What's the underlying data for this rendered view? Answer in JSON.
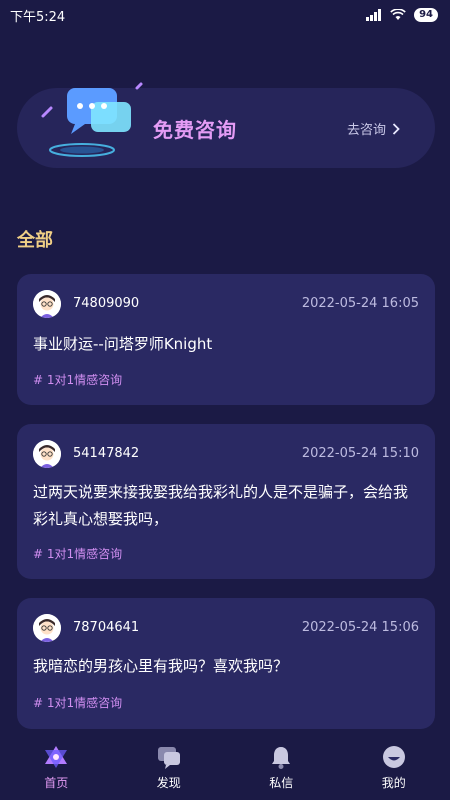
{
  "status_bar": {
    "time": "下午5:24",
    "battery": "94"
  },
  "banner": {
    "title": "免费咨询",
    "link_label": "去咨询"
  },
  "section": {
    "title": "全部"
  },
  "posts": [
    {
      "user_id": "74809090",
      "time": "2022-05-24 16:05",
      "text": "事业财运--问塔罗师Knight",
      "tag": "# 1对1情感咨询"
    },
    {
      "user_id": "54147842",
      "time": "2022-05-24 15:10",
      "text": "过两天说要来接我娶我给我彩礼的人是不是骗子，会给我彩礼真心想娶我吗，",
      "tag": "# 1对1情感咨询"
    },
    {
      "user_id": "78704641",
      "time": "2022-05-24 15:06",
      "text": "我暗恋的男孩心里有我吗？喜欢我吗？",
      "tag": "# 1对1情感咨询"
    }
  ],
  "nav": {
    "items": [
      {
        "label": "首页",
        "icon": "home-triangle-icon",
        "active": true
      },
      {
        "label": "发现",
        "icon": "discover-icon",
        "active": false
      },
      {
        "label": "私信",
        "icon": "bell-icon",
        "active": false
      },
      {
        "label": "我的",
        "icon": "profile-icon",
        "active": false
      }
    ]
  },
  "colors": {
    "background": "#1b1a45",
    "card": "#2a2963",
    "accent_pink": "#e49cf5",
    "accent_gold": "#f0cf86"
  }
}
